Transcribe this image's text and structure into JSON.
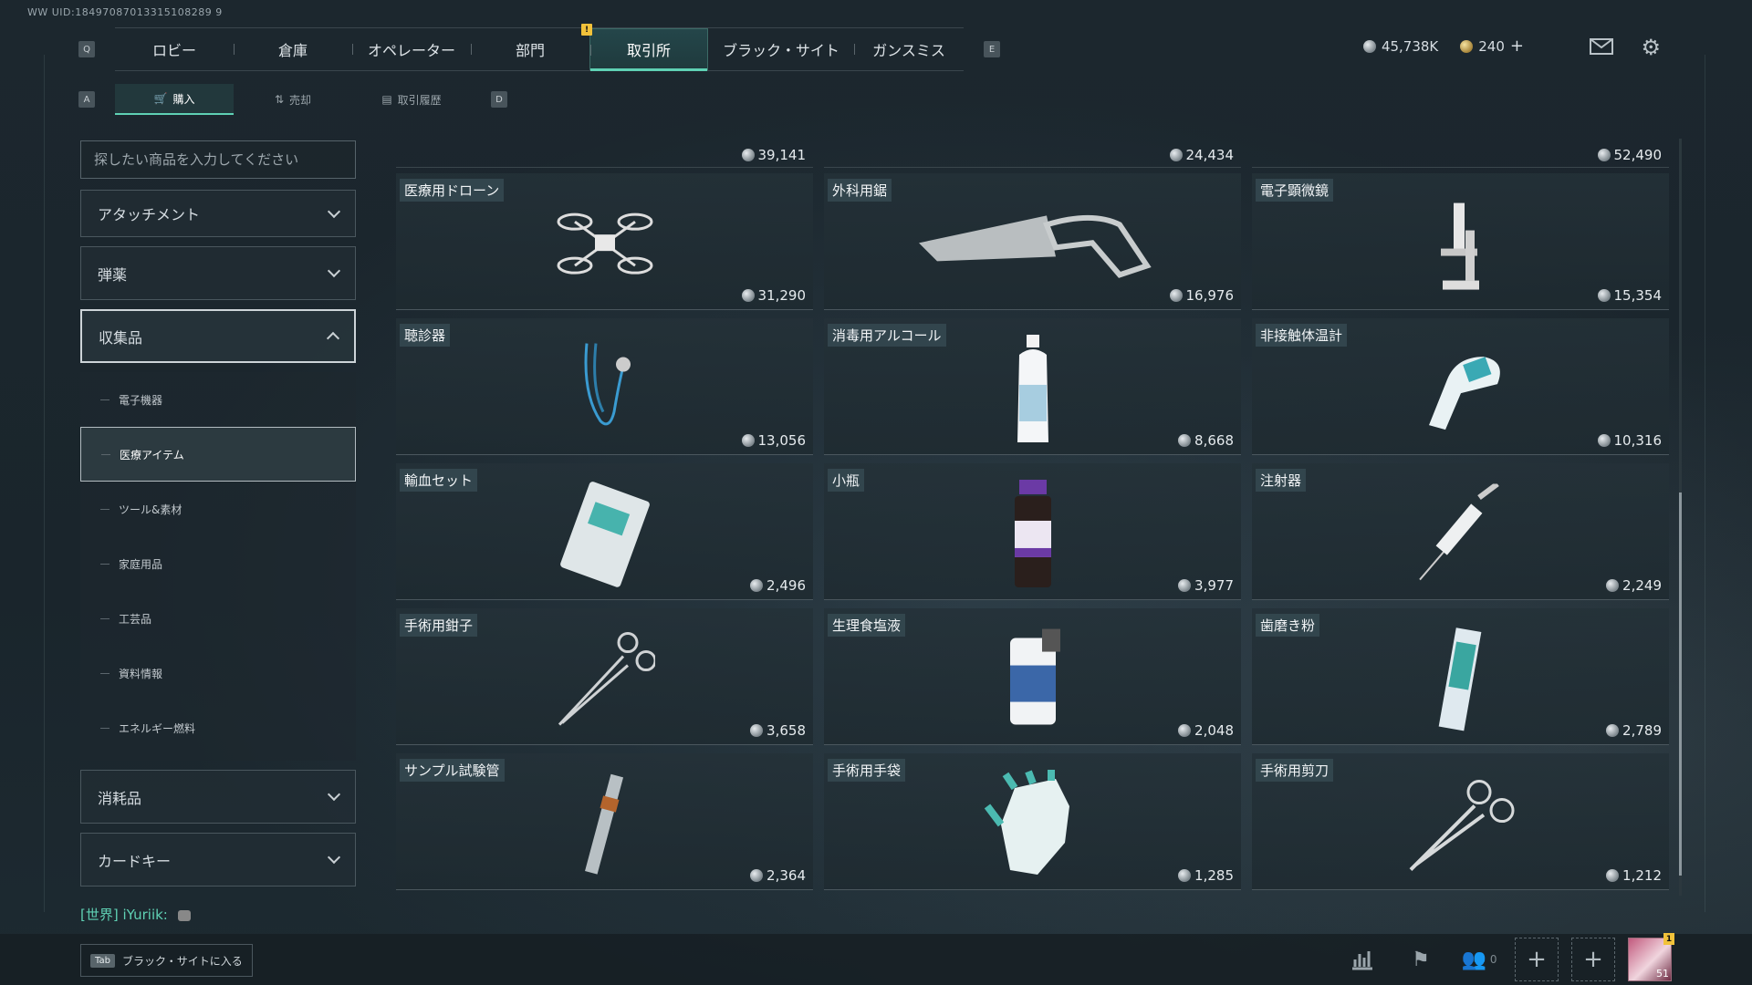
{
  "uid": "WW UID:18497087013315108289 9",
  "nav": {
    "key_left": "Q",
    "key_right": "E",
    "tabs": [
      {
        "label": "ロビー",
        "active": false
      },
      {
        "label": "倉庫",
        "active": false
      },
      {
        "label": "オペレーター",
        "active": false
      },
      {
        "label": "部門",
        "active": false
      },
      {
        "label": "取引所",
        "active": true,
        "notification": "!"
      },
      {
        "label": "ブラック・サイト",
        "active": false
      },
      {
        "label": "ガンスミス",
        "active": false
      }
    ]
  },
  "currency": {
    "silver": "45,738K",
    "gold": "240",
    "gold_plus": "+"
  },
  "subnav": {
    "key_left": "A",
    "key_right": "D",
    "tabs": [
      {
        "label": "購入",
        "icon": "cart-icon",
        "active": true
      },
      {
        "label": "売却",
        "icon": "sell-icon",
        "active": false
      },
      {
        "label": "取引履歴",
        "icon": "history-icon",
        "active": false
      }
    ]
  },
  "sidebar": {
    "search_placeholder": "探したい商品を入力してください",
    "categories_top": [
      {
        "label": "アタッチメント"
      },
      {
        "label": "弾薬"
      },
      {
        "label": "収集品",
        "open": true
      }
    ],
    "subitems": [
      {
        "label": "電子機器",
        "active": false
      },
      {
        "label": "医療アイテム",
        "active": true
      },
      {
        "label": "ツール&素材",
        "active": false
      },
      {
        "label": "家庭用品",
        "active": false
      },
      {
        "label": "工芸品",
        "active": false
      },
      {
        "label": "資料情報",
        "active": false
      },
      {
        "label": "エネルギー燃料",
        "active": false
      }
    ],
    "categories_bottom": [
      {
        "label": "消耗品"
      },
      {
        "label": "カードキー"
      }
    ]
  },
  "chat": {
    "channel": "[世界]",
    "user": "iYuriik:"
  },
  "top_prices": [
    "39,141",
    "24,434",
    "52,490"
  ],
  "items": [
    {
      "name": "医療用ドローン",
      "price": "31,290",
      "icon": "drone-icon"
    },
    {
      "name": "外科用鋸",
      "price": "16,976",
      "icon": "saw-icon"
    },
    {
      "name": "電子顕微鏡",
      "price": "15,354",
      "icon": "microscope-icon"
    },
    {
      "name": "聴診器",
      "price": "13,056",
      "icon": "stethoscope-icon"
    },
    {
      "name": "消毒用アルコール",
      "price": "8,668",
      "icon": "alcohol-bottle-icon"
    },
    {
      "name": "非接触体温計",
      "price": "10,316",
      "icon": "thermometer-icon"
    },
    {
      "name": "輸血セット",
      "price": "2,496",
      "icon": "transfusion-kit-icon"
    },
    {
      "name": "小瓶",
      "price": "3,977",
      "icon": "vial-icon"
    },
    {
      "name": "注射器",
      "price": "2,249",
      "icon": "syringe-icon"
    },
    {
      "name": "手術用鉗子",
      "price": "3,658",
      "icon": "forceps-icon"
    },
    {
      "name": "生理食塩液",
      "price": "2,048",
      "icon": "saline-icon"
    },
    {
      "name": "歯磨き粉",
      "price": "2,789",
      "icon": "toothpaste-icon"
    },
    {
      "name": "サンプル試験管",
      "price": "2,364",
      "icon": "test-tube-icon"
    },
    {
      "name": "手術用手袋",
      "price": "1,285",
      "icon": "gloves-icon"
    },
    {
      "name": "手術用剪刀",
      "price": "1,212",
      "icon": "scissors-icon"
    }
  ],
  "bottom": {
    "tab_key": "Tab",
    "black_site_label": "ブラック・サイトに入る",
    "friends_count": "0",
    "avatar_level": "51",
    "avatar_badge": "1"
  }
}
